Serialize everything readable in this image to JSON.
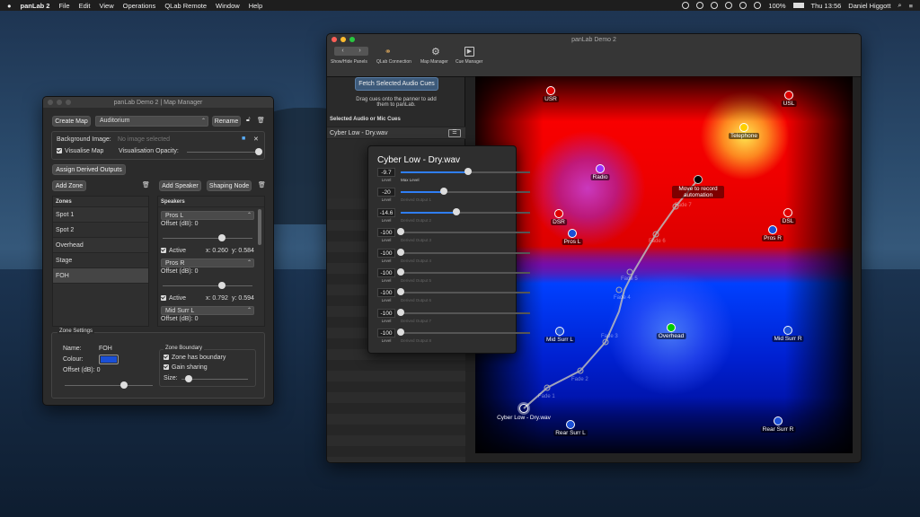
{
  "menubar": {
    "app": "panLab 2",
    "items": [
      "File",
      "Edit",
      "View",
      "Operations",
      "QLab Remote",
      "Window",
      "Help"
    ],
    "battery": "100%",
    "clock": "Thu 13:56",
    "user": "Daniel Higgott"
  },
  "map_manager": {
    "title": "panLab Demo 2 | Map Manager",
    "create_map": "Create Map",
    "map_select": "Auditorium",
    "rename": "Rename",
    "background_label": "Background Image:",
    "background_value": "No image selected",
    "visualise_map": "Visualise Map",
    "vis_opacity_label": "Visualisation Opacity:",
    "vis_opacity": 1.0,
    "assign_derived": "Assign Derived Outputs",
    "add_zone": "Add Zone",
    "add_speaker": "Add Speaker",
    "shaping_node": "Shaping Node",
    "zones_header": "Zones",
    "speakers_header": "Speakers",
    "zones": [
      "Spot 1",
      "Spot 2",
      "Overhead",
      "Stage",
      "FOH"
    ],
    "selected_zone": "FOH",
    "speakers": [
      {
        "name": "Pros L",
        "offset": "Offset (dB): 0",
        "active": "Active",
        "x": "x: 0.260",
        "y": "y: 0.584"
      },
      {
        "name": "Pros R",
        "offset": "Offset (dB): 0",
        "active": "Active",
        "x": "x: 0.792",
        "y": "y: 0.594"
      },
      {
        "name": "Mid Surr L",
        "offset": "Offset (dB): 0"
      }
    ],
    "zone_settings": {
      "header": "Zone Settings",
      "name_label": "Name:",
      "name_value": "FOH",
      "colour_label": "Colour:",
      "colour": "#1a4fd6",
      "offset_label": "Offset (dB): 0",
      "boundary_header": "Zone Boundary",
      "has_boundary": "Zone has boundary",
      "gain_sharing": "Gain sharing",
      "size_label": "Size:"
    }
  },
  "main": {
    "title": "panLab Demo 2",
    "toolbar": [
      "Show/Hide Panels",
      "QLab Connection",
      "Map Manager",
      "Cue Manager"
    ],
    "fetch_button": "Fetch Selected Audio Cues",
    "drag_hint": "Drag cues onto the panner to add them to panLab.",
    "selected_header": "Selected Audio or Mic Cues",
    "cue": "Cyber Low - Dry.wav"
  },
  "popover": {
    "title": "Cyber Low - Dry.wav",
    "level_label": "Level",
    "rows": [
      {
        "value": "-9.7",
        "sub": "Max Level",
        "frac": 0.52
      },
      {
        "value": "-20",
        "sub": "Derived Output 1",
        "frac": 0.33
      },
      {
        "value": "-14.6",
        "sub": "Derived Output 2",
        "frac": 0.43
      },
      {
        "value": "-100",
        "sub": "Derived Output 3",
        "frac": 0.0
      },
      {
        "value": "-100",
        "sub": "Derived Output 4",
        "frac": 0.0
      },
      {
        "value": "-100",
        "sub": "Derived Output 5",
        "frac": 0.0
      },
      {
        "value": "-100",
        "sub": "Derived Output 6",
        "frac": 0.0
      },
      {
        "value": "-100",
        "sub": "Derived Output 7",
        "frac": 0.0
      },
      {
        "value": "-100",
        "sub": "Derived Output 8",
        "frac": 0.0
      }
    ]
  },
  "panner": {
    "speakers": [
      {
        "name": "USR",
        "color": "#e00000"
      },
      {
        "name": "USL",
        "color": "#e00000"
      },
      {
        "name": "Telephone",
        "color": "#ffd000"
      },
      {
        "name": "Radio",
        "color": "#9b30ff"
      },
      {
        "name": "DSR",
        "color": "#e00000"
      },
      {
        "name": "DSL",
        "color": "#e00000"
      },
      {
        "name": "Pros L",
        "color": "#1a4fd6"
      },
      {
        "name": "Pros R",
        "color": "#1a4fd6"
      },
      {
        "name": "Mid Surr L",
        "color": "#1a4fd6"
      },
      {
        "name": "Overhead",
        "color": "#00cc00"
      },
      {
        "name": "Mid Surr R",
        "color": "#1a4fd6"
      },
      {
        "name": "Rear Surr L",
        "color": "#1a4fd6"
      },
      {
        "name": "Rear Surr R",
        "color": "#1a4fd6"
      }
    ],
    "automation_label": "Move to record automation",
    "source": "Cyber Low - Dry.wav",
    "fades": [
      "Fade 1",
      "Fade 2",
      "Fade 3",
      "Fade 4",
      "Fade 5",
      "Fade 6",
      "Fade 7"
    ]
  }
}
